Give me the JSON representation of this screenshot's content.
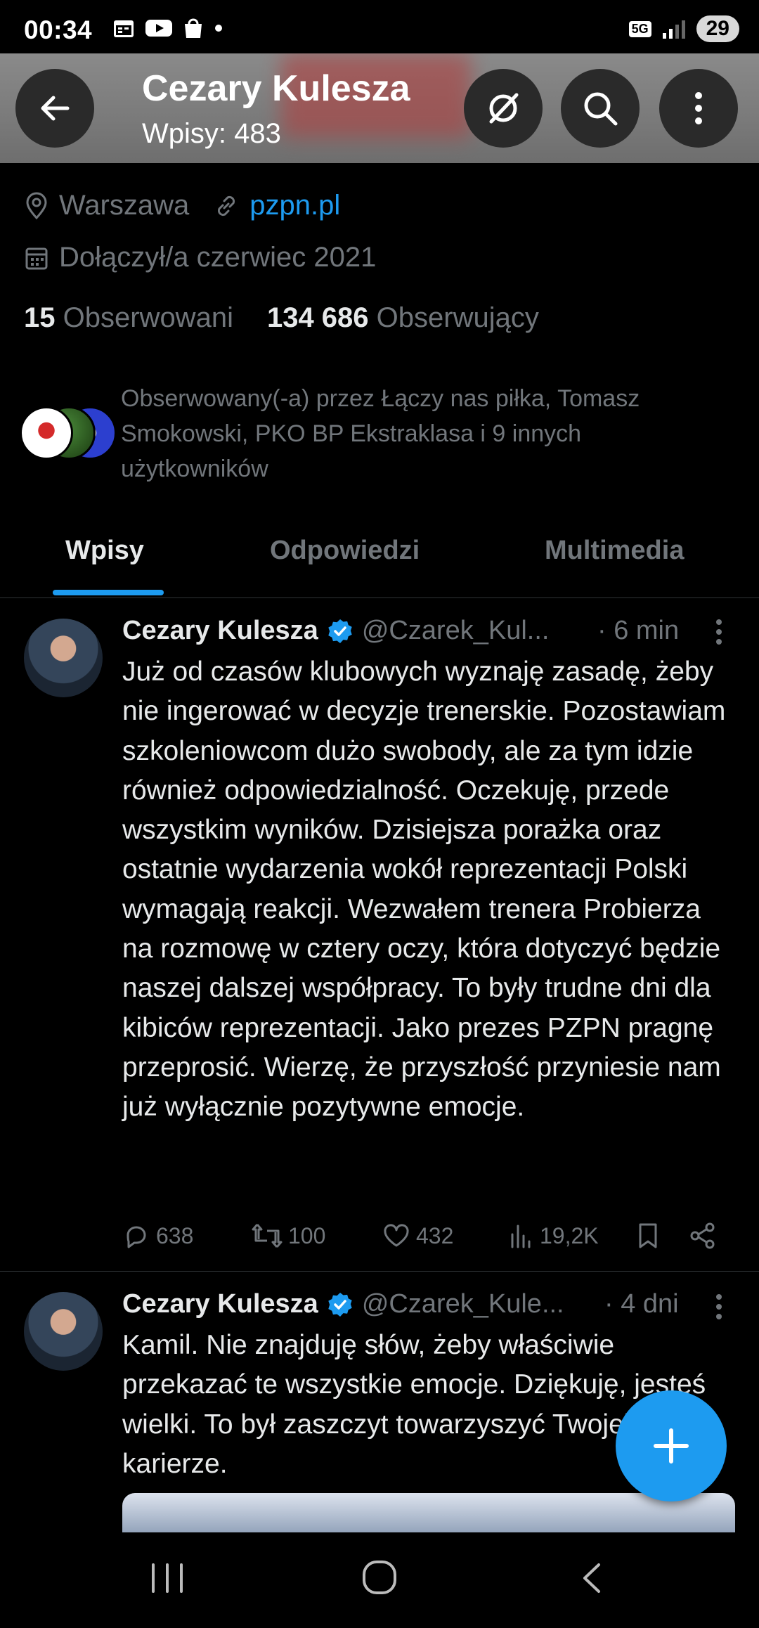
{
  "status_bar": {
    "time": "00:34",
    "network": "5G",
    "battery": "29"
  },
  "header": {
    "name": "Cezary Kulesza",
    "posts_count": "Wpisy: 483"
  },
  "profile": {
    "location": "Warszawa",
    "website": "pzpn.pl",
    "joined": "Dołączył/a czerwiec 2021",
    "following_count": "15",
    "following_label": "Obserwowani",
    "followers_count": "134 686",
    "followers_label": "Obserwujący",
    "followed_by": "Obserwowany(-a) przez Łączy nas piłka, Tomasz Smokowski, PKO BP Ekstraklasa i 9 innych użytkowników"
  },
  "tabs": [
    {
      "label": "Wpisy",
      "active": true
    },
    {
      "label": "Odpowiedzi",
      "active": false
    },
    {
      "label": "Multimedia",
      "active": false
    }
  ],
  "tweets": [
    {
      "name": "Cezary Kulesza",
      "handle": "@Czarek_Kul...",
      "time": "· 6 min",
      "text": "Już od czasów klubowych wyznaję zasadę, żeby nie ingerować w decyzje trenerskie. Pozostawiam szkoleniowcom dużo swobody, ale za tym idzie również odpowiedzialność. Oczekuję, przede wszystkim wyników. Dzisiejsza porażka oraz ostatnie wydarzenia wokół reprezentacji Polski wymagają reakcji. Wezwałem trenera Probierza na rozmowę w cztery oczy, która dotyczyć będzie naszej dalszej współpracy. To były trudne dni dla kibiców reprezentacji. Jako prezes PZPN pragnę przeprosić. Wierzę, że przyszłość przyniesie nam już wyłącznie pozytywne emocje.",
      "replies": "638",
      "reposts": "100",
      "likes": "432",
      "views": "19,2K"
    },
    {
      "name": "Cezary Kulesza",
      "handle": "@Czarek_Kule...",
      "time": "· 4 dni",
      "text": "Kamil. Nie znajduję słów, żeby właściwie przekazać te wszystkie emocje. Dziękuję, jesteś wielki. To był zaszczyt towarzyszyć Twojej karierze."
    }
  ],
  "colors": {
    "accent": "#1d9bf0",
    "background": "#000000",
    "muted_text": "#71767b",
    "primary_text": "#e7e9ea"
  }
}
